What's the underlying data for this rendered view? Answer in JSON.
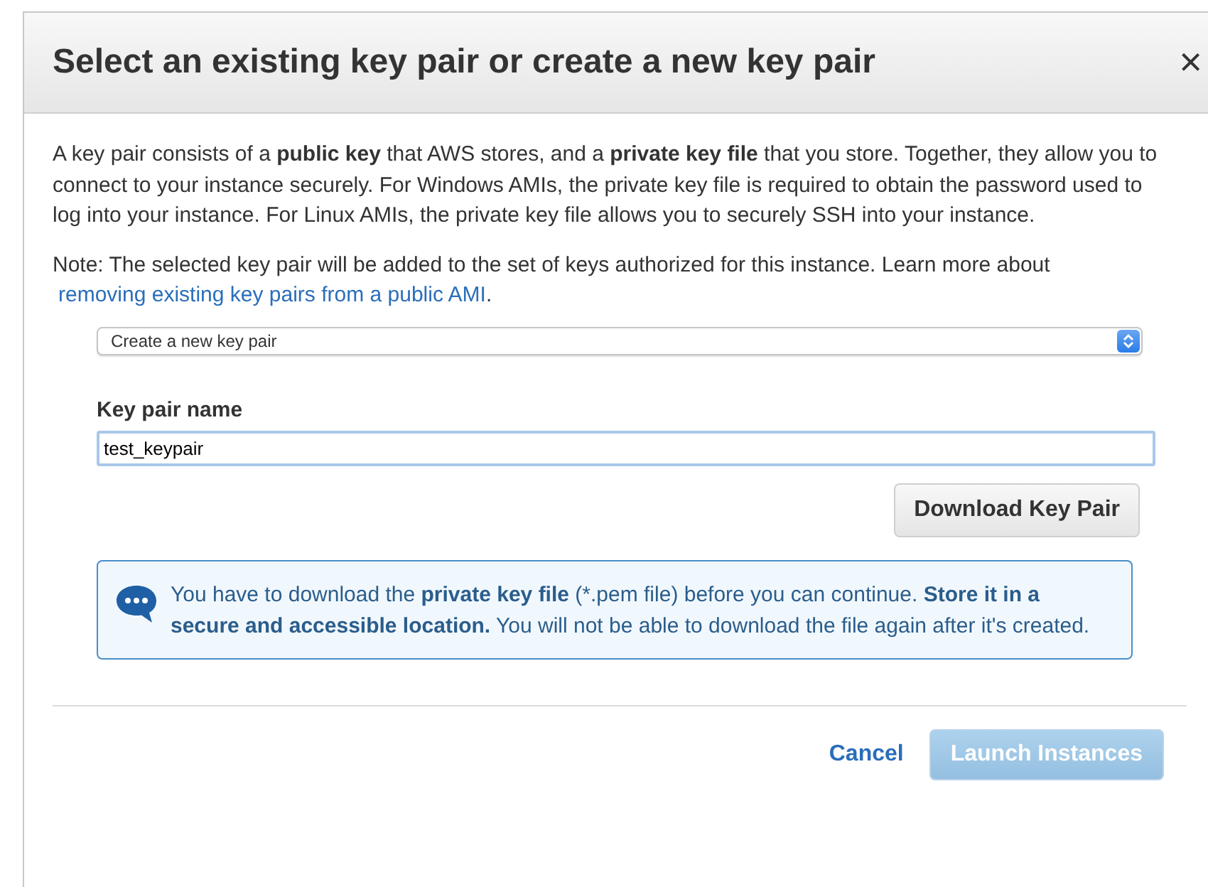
{
  "dialog": {
    "title": "Select an existing key pair or create a new key pair",
    "close": "×"
  },
  "intro": "A key pair consists of a **public key** that AWS stores, and a **private key file** that you store. Together, they allow you to connect to your instance securely. For Windows AMIs, the private key file is required to obtain the password used to log into your instance. For Linux AMIs, the private key file allows you to securely SSH into your instance.",
  "note": {
    "text": "Note: The selected key pair will be added to the set of keys authorized for this instance. Learn more about ",
    "link": "removing existing key pairs from a public AMI",
    "after": "."
  },
  "key_pair_select": {
    "value": "Create a new key pair"
  },
  "key_pair_name": {
    "label": "Key pair name",
    "value": "test_keypair"
  },
  "download_button": {
    "label": "Download Key Pair",
    "disabled": false
  },
  "info": "You have to download the **private key file** (*.pem file) before you can continue. **Store it in a secure and accessible location.** You will not be able to download the file again after it's created.",
  "footer": {
    "cancel": "Cancel",
    "launch": {
      "label": "Launch Instances",
      "disabled": true
    }
  }
}
